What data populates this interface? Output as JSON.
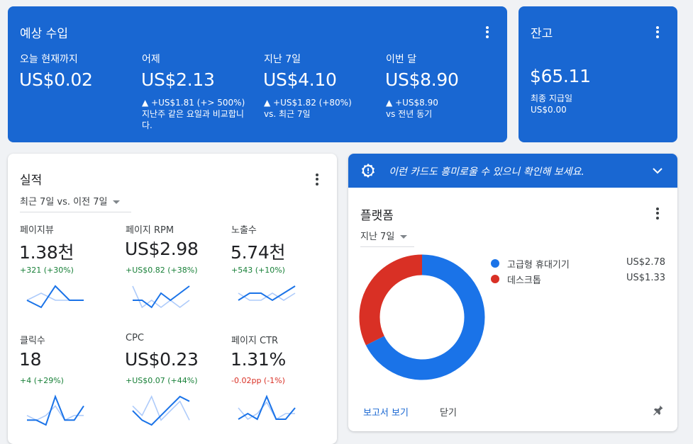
{
  "earnings": {
    "title": "예상 수입",
    "items": [
      {
        "label": "오늘 현재까지",
        "value": "US$0.02",
        "delta": "",
        "note": ""
      },
      {
        "label": "어제",
        "value": "US$2.13",
        "delta": "▲ +US$1.81 (+> 500%)",
        "note": "지난주 같은 요일과 비교합니다."
      },
      {
        "label": "지난 7일",
        "value": "US$4.10",
        "delta": "▲ +US$1.82 (+80%)",
        "note": "vs. 최근 7일"
      },
      {
        "label": "이번 달",
        "value": "US$8.90",
        "delta": "▲ +US$8.90",
        "note": "vs 전년 동기"
      }
    ]
  },
  "balance": {
    "title": "잔고",
    "value": "$65.11",
    "last_payment_label": "최종 지급일",
    "last_payment_value": "US$0.00"
  },
  "performance": {
    "title": "실적",
    "range": "최근 7일 vs. 이전 7일",
    "metrics": [
      {
        "label": "페이지뷰",
        "value": "1.38천",
        "delta": "+321 (+30%)",
        "trend": "up",
        "series": [
          2,
          1,
          4,
          2,
          2
        ],
        "prev": [
          2,
          3,
          2,
          2,
          2
        ]
      },
      {
        "label": "페이지 RPM",
        "value": "US$2.98",
        "delta": "+US$0.82 (+38%)",
        "trend": "up",
        "series": [
          2,
          2,
          1,
          3,
          2,
          3,
          4
        ],
        "prev": [
          4,
          1,
          2,
          1,
          2,
          1,
          2
        ]
      },
      {
        "label": "노출수",
        "value": "5.74천",
        "delta": "+543 (+10%)",
        "trend": "up",
        "series": [
          2,
          3,
          3,
          2,
          3,
          4
        ],
        "prev": [
          3,
          2,
          2,
          3,
          2,
          3
        ]
      },
      {
        "label": "클릭수",
        "value": "18",
        "delta": "+4 (+29%)",
        "trend": "up",
        "series": [
          1,
          1,
          0,
          6,
          1,
          1,
          4
        ],
        "prev": [
          2,
          1,
          2,
          4,
          1,
          2,
          2
        ]
      },
      {
        "label": "CPC",
        "value": "US$0.23",
        "delta": "+US$0.07 (+44%)",
        "trend": "up",
        "series": [
          3,
          1,
          0,
          2,
          4,
          6,
          5
        ],
        "prev": [
          4,
          2,
          6,
          1,
          3,
          5,
          1
        ]
      },
      {
        "label": "페이지 CTR",
        "value": "1.31%",
        "delta": "-0.02pp (-1%)",
        "trend": "down",
        "series": [
          1,
          2,
          1,
          5,
          1,
          1,
          3
        ],
        "prev": [
          3,
          1,
          2,
          4,
          1,
          2,
          2
        ]
      }
    ]
  },
  "platform": {
    "banner": "이런 카드도 흥미로울 수 있으니 확인해 보세요.",
    "title": "플랫폼",
    "range": "지난 7일",
    "legend": [
      {
        "label": "고급형 휴대기기",
        "value": "US$2.78",
        "color": "#1a73e8",
        "amount": 2.78
      },
      {
        "label": "데스크톱",
        "value": "US$1.33",
        "color": "#d93025",
        "amount": 1.33
      }
    ],
    "view_report": "보고서 보기",
    "close": "닫기"
  },
  "colors": {
    "accent": "#1967d2",
    "positive": "#188038",
    "negative": "#d93025",
    "chart_line": "#1a73e8",
    "chart_prev": "#aecbfa"
  }
}
